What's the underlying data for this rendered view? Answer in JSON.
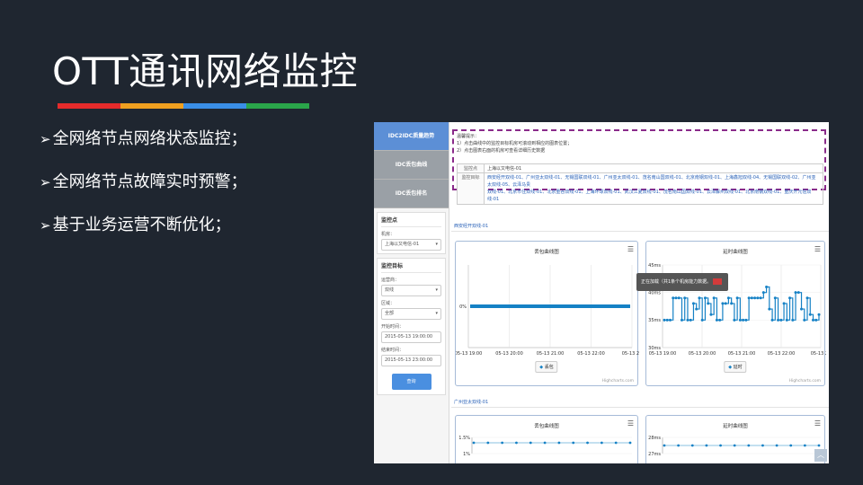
{
  "slide": {
    "title": "OTT通讯网络监控",
    "bar_colors": [
      "#e52b2b",
      "#f0a020",
      "#3a8ee6",
      "#2aa54a"
    ],
    "bullets": [
      "全网络节点网络状态监控；",
      "全网络节点故障实时预警；",
      "基于业务运营不断优化；"
    ]
  },
  "shot": {
    "tabs": [
      "IDC2IDC质量趋势",
      "IDC丢包曲线",
      "IDC丢包排名"
    ],
    "monitor_point": {
      "heading": "监控点",
      "room_label": "机房：",
      "room_value": "上海以又电信-01"
    },
    "monitor_target": {
      "heading": "监控目标",
      "operator_label": "运营商：",
      "operator_value": "双线",
      "region_label": "区域：",
      "region_value": "全部",
      "start_label": "开始时间：",
      "start_value": "2015-05-13 19:00:00",
      "end_label": "结束时间：",
      "end_value": "2015-05-13 23:00:00",
      "query_button": "查询"
    },
    "hint": {
      "title": "温馨提示：",
      "line1": "1）点击曲线中的监控目标机房可滚动到相应的图表位置；",
      "line2": "2）点击图表右面的机房可查看详细历史数据",
      "row1_key": "监控点",
      "row1_value": "上海以又电信-01",
      "row2_key": "监控目标",
      "row2_line1": "西安经开双线-01、广州亚太双线-01、无锡国联双线-01、广州亚太双线-01、茂名南山国双线-01、北京南钢双线-01、上海鑫旭双线-04、无锡国联双线-02、广州亚太双线-05、云泽马贵",
      "row2_line2": "双线-01、北京市住双线-01、北京重谷双线-01、上海环球双线-01、武汉江夏双线-01、茂名南山国双线-01、云泽解州双线-01、北京南钢双线-01、重庆开元信双线-01"
    },
    "section1_label": "西安经开双线-01",
    "section2_label": "广州亚太双线-01",
    "loading_text": "正在加载（共1条个机房能力数据。",
    "credit": "Highcharts.com",
    "scroll_top_icon": "chevron-up-icon"
  },
  "chart_data": [
    {
      "type": "line",
      "title": "丢包曲线图",
      "x": [
        "05-13 19:00",
        "05-13 20:00",
        "05-13 21:00",
        "05-13 22:00",
        "05-13 23"
      ],
      "ytick_labels": [
        "0%"
      ],
      "series": [
        {
          "name": "丢包",
          "values": [
            0,
            0,
            0,
            0,
            0,
            0,
            0,
            0,
            0,
            0,
            0,
            0,
            0,
            0,
            0,
            0,
            0,
            0,
            0,
            0,
            0,
            0,
            0,
            0,
            0,
            0,
            0,
            0,
            0,
            0,
            0,
            0,
            0,
            0,
            0,
            0,
            0,
            0,
            0,
            0,
            0,
            0,
            0,
            0,
            0,
            0,
            0,
            0,
            0
          ]
        }
      ],
      "ylim": [
        -0.5,
        0.5
      ]
    },
    {
      "type": "line",
      "title": "延时曲线图",
      "x": [
        "05-13 19:00",
        "05-13 20:00",
        "05-13 21:00",
        "05-13 22:00",
        "05-13 23"
      ],
      "ytick_labels": [
        "45ms",
        "40ms",
        "35ms",
        "30ms"
      ],
      "series": [
        {
          "name": "延时",
          "values": [
            35,
            35,
            35,
            39,
            39,
            39,
            35,
            39,
            35,
            35,
            38,
            37,
            39,
            35,
            39,
            38,
            36,
            39,
            35,
            35,
            38,
            38,
            39,
            38,
            35,
            39,
            35,
            35,
            35,
            39,
            39,
            39,
            39,
            39,
            40,
            41,
            37,
            35,
            39,
            35,
            35,
            38,
            35,
            39,
            35,
            40,
            40,
            37,
            35,
            39,
            36,
            35,
            35,
            36
          ]
        }
      ],
      "ylim": [
        30,
        45
      ]
    },
    {
      "type": "line",
      "title": "丢包曲线图",
      "ytick_labels": [
        "1.5%",
        "1%"
      ],
      "series": [
        {
          "name": "丢包",
          "values": [
            1,
            1,
            1,
            1,
            1,
            1,
            1,
            1,
            1,
            1,
            1,
            1
          ]
        }
      ],
      "ylim": [
        0,
        1.5
      ]
    },
    {
      "type": "line",
      "title": "延时曲线图",
      "ytick_labels": [
        "28ms",
        "27ms"
      ],
      "series": [
        {
          "name": "延时",
          "values": [
            27,
            27,
            27,
            27,
            27,
            27,
            27,
            27,
            27,
            27,
            27,
            27
          ]
        }
      ],
      "ylim": [
        26,
        28
      ]
    }
  ]
}
